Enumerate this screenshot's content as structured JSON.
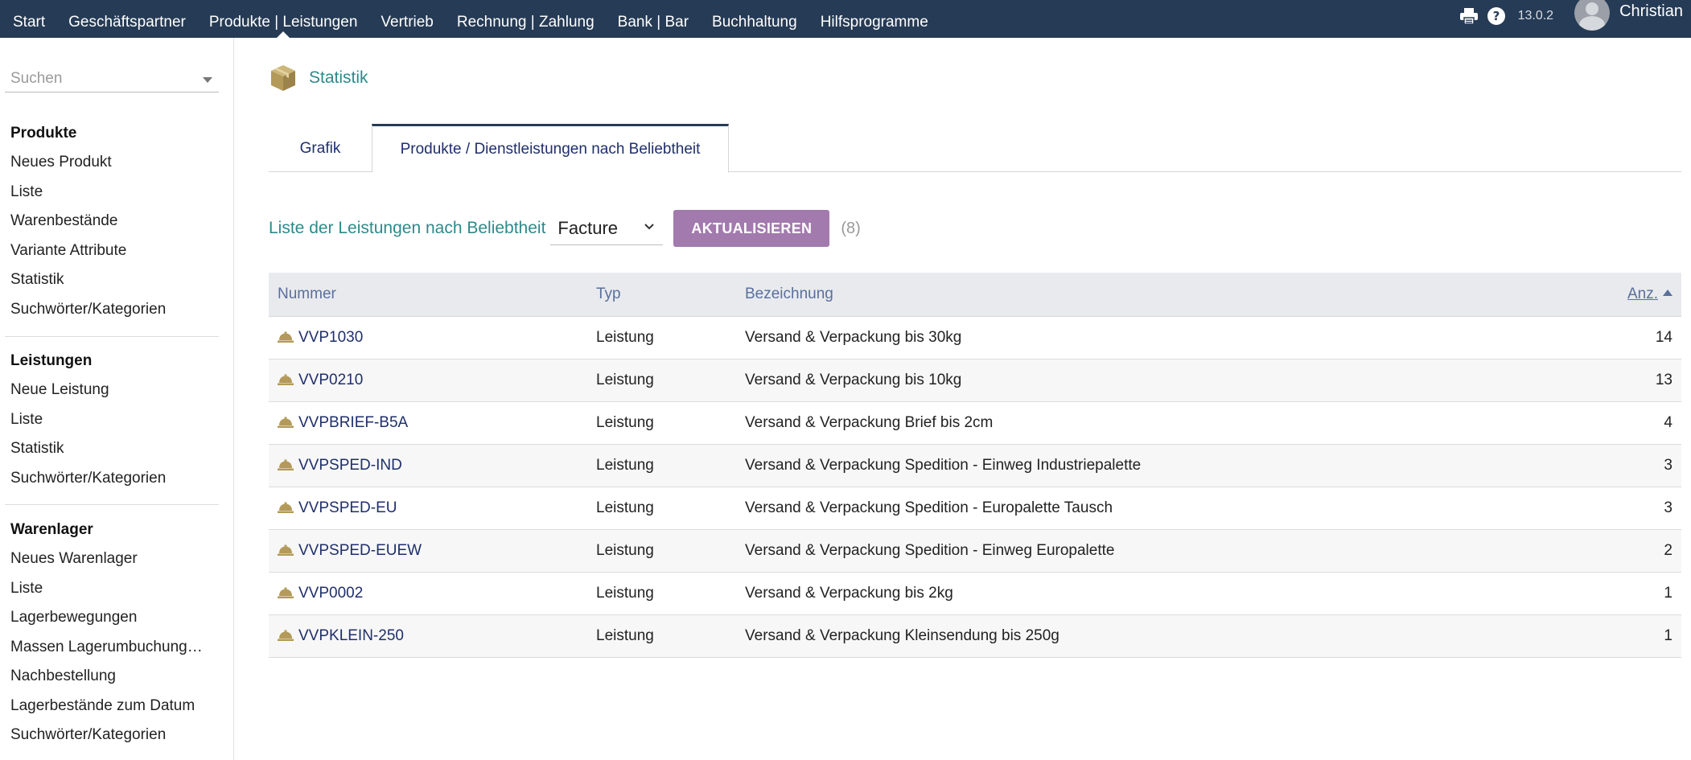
{
  "topnav": {
    "items": [
      {
        "label": "Start",
        "active": false
      },
      {
        "label": "Geschäftspartner",
        "active": false
      },
      {
        "label": "Produkte | Leistungen",
        "active": true
      },
      {
        "label": "Vertrieb",
        "active": false
      },
      {
        "label": "Rechnung | Zahlung",
        "active": false
      },
      {
        "label": "Bank | Bar",
        "active": false
      },
      {
        "label": "Buchhaltung",
        "active": false
      },
      {
        "label": "Hilfsprogramme",
        "active": false
      }
    ],
    "icons": [
      "print-icon",
      "help-icon"
    ],
    "version": "13.0.2",
    "user": "Christian"
  },
  "sidebar": {
    "search_placeholder": "Suchen",
    "sections": [
      {
        "title": "Produkte",
        "items": [
          "Neues Produkt",
          "Liste",
          "Warenbestände",
          "Variante Attribute",
          "Statistik",
          "Suchwörter/Kategorien"
        ]
      },
      {
        "title": "Leistungen",
        "items": [
          "Neue Leistung",
          "Liste",
          "Statistik",
          "Suchwörter/Kategorien"
        ]
      },
      {
        "title": "Warenlager",
        "items": [
          "Neues Warenlager",
          "Liste",
          "Lagerbewegungen",
          "Massen Lagerumbuchung…",
          "Nachbestellung",
          "Lagerbestände zum Datum",
          "Suchwörter/Kategorien"
        ]
      }
    ]
  },
  "main": {
    "page_title": "Statistik",
    "tabs": [
      {
        "label": "Grafik",
        "active": false
      },
      {
        "label": "Produkte / Dienstleistungen nach Beliebtheit",
        "active": true
      }
    ],
    "toolbar": {
      "label": "Liste der Leistungen nach Beliebtheit",
      "select_value": "Facture",
      "refresh_label": "AKTUALISIEREN",
      "count": "(8)"
    },
    "table": {
      "headers": {
        "nummer": "Nummer",
        "typ": "Typ",
        "bezeichnung": "Bezeichnung",
        "anz": "Anz."
      },
      "rows": [
        {
          "nummer": "VVP1030",
          "typ": "Leistung",
          "bezeichnung": "Versand & Verpackung bis 30kg",
          "anz": "14"
        },
        {
          "nummer": "VVP0210",
          "typ": "Leistung",
          "bezeichnung": "Versand & Verpackung bis 10kg",
          "anz": "13"
        },
        {
          "nummer": "VVPBRIEF-B5A",
          "typ": "Leistung",
          "bezeichnung": "Versand & Verpackung Brief bis 2cm",
          "anz": "4"
        },
        {
          "nummer": "VVPSPED-IND",
          "typ": "Leistung",
          "bezeichnung": "Versand & Verpackung Spedition - Einweg Industriepalette",
          "anz": "3"
        },
        {
          "nummer": "VVPSPED-EU",
          "typ": "Leistung",
          "bezeichnung": "Versand & Verpackung Spedition - Europalette Tausch",
          "anz": "3"
        },
        {
          "nummer": "VVPSPED-EUEW",
          "typ": "Leistung",
          "bezeichnung": "Versand & Verpackung Spedition - Einweg Europalette",
          "anz": "2"
        },
        {
          "nummer": "VVP0002",
          "typ": "Leistung",
          "bezeichnung": "Versand & Verpackung bis 2kg",
          "anz": "1"
        },
        {
          "nummer": "VVPKLEIN-250",
          "typ": "Leistung",
          "bezeichnung": "Versand & Verpackung Kleinsendung bis 250g",
          "anz": "1"
        }
      ]
    }
  },
  "colors": {
    "topbar": "#263b55",
    "accent_teal": "#2e8a8a",
    "button_purple": "#a27aae",
    "link_navy": "#1f2f6a",
    "icon_gold": "#b39a5a"
  }
}
